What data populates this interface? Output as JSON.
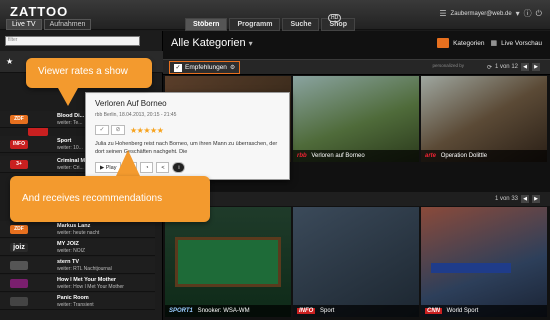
{
  "header": {
    "logo": "ZATTOO",
    "live_tabs": [
      "Live TV",
      "Aufnahmen"
    ],
    "nav_tabs": [
      "Stöbern",
      "Programm",
      "Suche",
      "Shop"
    ],
    "hd_badge": "HD",
    "user_email": "Zaubermayer@web.de"
  },
  "sidebar": {
    "search_placeholder": "filter",
    "channels": [
      {
        "logo": "ZDF",
        "name": "Blood Di...",
        "next": "weiter: Te...",
        "color": "#e7701f"
      },
      {
        "logo": "INFO",
        "name": "Sport",
        "next": "weiter: 10...",
        "color": "#c92020"
      },
      {
        "logo": "3+",
        "name": "Criminal M...",
        "next": "weiter: Cri...",
        "color": "#c92020"
      },
      {
        "logo": "ZDF",
        "name": "Markus Lanz",
        "next": "weiter: heute nacht",
        "color": "#e7701f"
      },
      {
        "logo": "joiz",
        "name": "MY JOIZ",
        "next": "weiter: NOIZ",
        "color": "#2a2a2a"
      },
      {
        "logo": "",
        "name": "stern TV",
        "next": "weiter: RTL Nachtjournal",
        "color": "#2a2a2a"
      },
      {
        "logo": "",
        "name": "How I Met Your Mother",
        "next": "weiter: How I Met Your Mother",
        "color": "#2a2a2a"
      },
      {
        "logo": "",
        "name": "Panic Room",
        "next": "weiter: Transient",
        "color": "#2a2a2a"
      }
    ]
  },
  "main": {
    "title": "Alle Kategorien",
    "view_kategorien": "Kategorien",
    "view_vorschau": "Live Vorschau",
    "row1": {
      "filter_label": "Empfehlungen",
      "personal_label": "personalized by",
      "pager": "1 von 12",
      "tiles": [
        {
          "channel": "rbb",
          "title": "Verloren auf Borneo"
        },
        {
          "channel": "arte",
          "title": "Operation Dolittle"
        }
      ]
    },
    "row2": {
      "pager": "1 von 33",
      "tiles": [
        {
          "channel": "SPORT1",
          "title": "Snooker: WSA-WM"
        },
        {
          "channel": "INFO",
          "title": "Sport"
        },
        {
          "channel": "CNN",
          "title": "World Sport"
        }
      ]
    }
  },
  "popup": {
    "title": "Verloren Auf Borneo",
    "meta": "rbb Berlin, 18.04.2013, 20:15 - 21:45",
    "rating_stars": "★★★★★",
    "rating_value": 5,
    "description": "Julia zu Hohenberg reist nach Borneo, um ihren Mann zu überraschen, der dort seinen Geschäften nachgeht. Die",
    "play_label": "Play"
  },
  "callouts": {
    "first": "Viewer rates a show",
    "second": "And receives recommendations"
  },
  "colors": {
    "accent": "#f39a2e",
    "stars": "#f7a21b"
  }
}
